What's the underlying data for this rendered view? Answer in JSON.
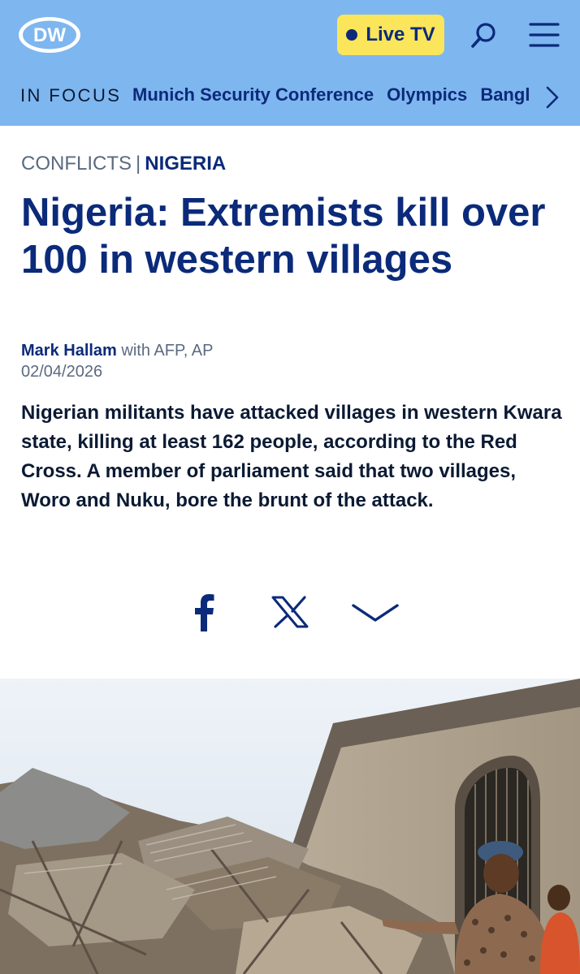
{
  "header": {
    "logo_text": "DW",
    "live_label": "Live TV",
    "search_icon": "search-icon",
    "menu_icon": "hamburger-menu-icon",
    "colors": {
      "header_bg": "#7eb6ef",
      "live_bg": "#fbe55a",
      "brand_navy": "#0b2a7a"
    }
  },
  "focus": {
    "label": "IN FOCUS",
    "links": [
      "Munich Security Conference",
      "Olympics",
      "Bangla"
    ],
    "next_icon": "chevron-right-icon"
  },
  "article": {
    "category": "CONFLICTS",
    "separator": "|",
    "country": "NIGERIA",
    "headline": "Nigeria: Extremists kill over 100 in western villages",
    "author": "Mark Hallam",
    "author_suffix": " with AFP, AP",
    "date": "02/04/2026",
    "teaser": "Nigerian militants have attacked villages in western Kwara state, killing at least 162 people, according to the Red Cross. A member of parliament said that two villages, Woro and Nuku, bore the brunt of the attack."
  },
  "share": {
    "facebook_icon": "facebook-icon",
    "x_icon": "x-icon",
    "more_icon": "chevron-down-icon"
  }
}
